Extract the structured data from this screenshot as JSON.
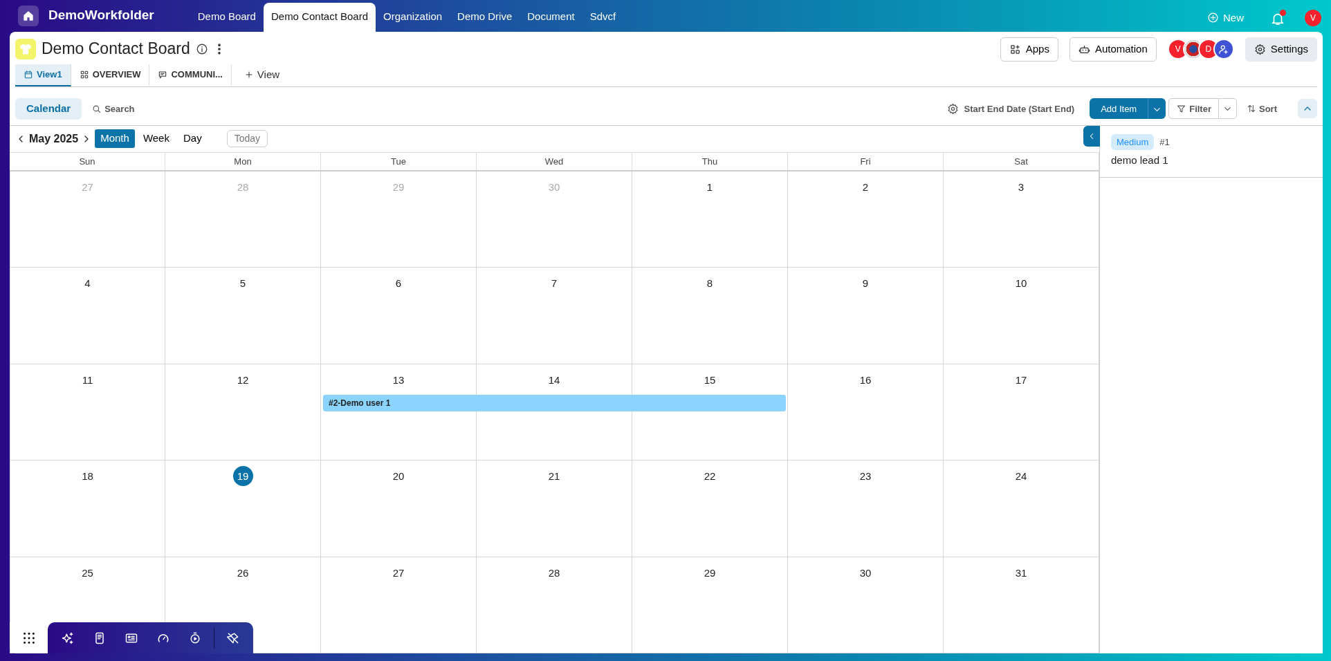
{
  "app": {
    "title": "DemoWorkfolder"
  },
  "top_tabs": [
    {
      "label": "Demo Board",
      "selected": false
    },
    {
      "label": "Demo Contact Board",
      "selected": true
    },
    {
      "label": "Organization",
      "selected": false
    },
    {
      "label": "Demo Drive",
      "selected": false
    },
    {
      "label": "Document",
      "selected": false
    },
    {
      "label": "Sdvcf",
      "selected": false
    }
  ],
  "new_button": "New",
  "notifications": {
    "unread": true
  },
  "user_avatar": "V",
  "board": {
    "title": "Demo Contact Board"
  },
  "header_buttons": [
    "Apps",
    "Automation"
  ],
  "members": [
    {
      "kind": "letter",
      "label": "V",
      "color": "#f5222d"
    },
    {
      "kind": "photo"
    },
    {
      "kind": "letter",
      "label": "D",
      "color": "#f5222d"
    },
    {
      "kind": "add",
      "color": "#3f51d4"
    }
  ],
  "settings_button": "Settings",
  "view_tabs": [
    {
      "label": "View1",
      "kind": "calendar",
      "selected": true
    },
    {
      "label": "OVERVIEW",
      "kind": "grid",
      "selected": false
    },
    {
      "label": "COMMUNI...",
      "kind": "chat",
      "selected": false
    }
  ],
  "add_view": "View",
  "toolbar": {
    "calendar_button": {
      "label": "Calendar",
      "selected": true
    },
    "search": "Search",
    "date_field": "Start End Date (Start End)",
    "add_item": "Add Item",
    "filter": "Filter",
    "sort": "Sort"
  },
  "calendar": {
    "month": "May 2025",
    "modes": [
      {
        "label": "Month",
        "selected": true
      },
      {
        "label": "Week",
        "selected": false
      },
      {
        "label": "Day",
        "selected": false
      }
    ],
    "today_button": "Today",
    "weekdays": [
      "Sun",
      "Mon",
      "Tue",
      "Wed",
      "Thu",
      "Fri",
      "Sat"
    ],
    "weeks": [
      [
        {
          "n": "27",
          "muted": true,
          "today": false
        },
        {
          "n": "28",
          "muted": true,
          "today": false
        },
        {
          "n": "29",
          "muted": true,
          "today": false
        },
        {
          "n": "30",
          "muted": true,
          "today": false
        },
        {
          "n": "1",
          "muted": false,
          "today": false
        },
        {
          "n": "2",
          "muted": false,
          "today": false
        },
        {
          "n": "3",
          "muted": false,
          "today": false
        }
      ],
      [
        {
          "n": "4",
          "muted": false,
          "today": false
        },
        {
          "n": "5",
          "muted": false,
          "today": false
        },
        {
          "n": "6",
          "muted": false,
          "today": false
        },
        {
          "n": "7",
          "muted": false,
          "today": false
        },
        {
          "n": "8",
          "muted": false,
          "today": false
        },
        {
          "n": "9",
          "muted": false,
          "today": false
        },
        {
          "n": "10",
          "muted": false,
          "today": false
        }
      ],
      [
        {
          "n": "11",
          "muted": false,
          "today": false
        },
        {
          "n": "12",
          "muted": false,
          "today": false
        },
        {
          "n": "13",
          "muted": false,
          "today": false,
          "event": "#2-Demo user 1"
        },
        {
          "n": "14",
          "muted": false,
          "today": false,
          "event_continues": true
        },
        {
          "n": "15",
          "muted": false,
          "today": false,
          "event_continues": true
        },
        {
          "n": "16",
          "muted": false,
          "today": false
        },
        {
          "n": "17",
          "muted": false,
          "today": false
        }
      ],
      [
        {
          "n": "18",
          "muted": false,
          "today": false
        },
        {
          "n": "19",
          "muted": false,
          "today": true
        },
        {
          "n": "20",
          "muted": false,
          "today": false
        },
        {
          "n": "21",
          "muted": false,
          "today": false
        },
        {
          "n": "22",
          "muted": false,
          "today": false
        },
        {
          "n": "23",
          "muted": false,
          "today": false
        },
        {
          "n": "24",
          "muted": false,
          "today": false
        }
      ],
      [
        {
          "n": "25",
          "muted": false,
          "today": false
        },
        {
          "n": "26",
          "muted": false,
          "today": false
        },
        {
          "n": "27",
          "muted": false,
          "today": false
        },
        {
          "n": "28",
          "muted": false,
          "today": false
        },
        {
          "n": "29",
          "muted": false,
          "today": false
        },
        {
          "n": "30",
          "muted": false,
          "today": false
        },
        {
          "n": "31",
          "muted": false,
          "today": false
        }
      ]
    ]
  },
  "side_panel": {
    "items": [
      {
        "tag": "Medium",
        "number": "#1",
        "title": "demo lead 1"
      }
    ]
  }
}
